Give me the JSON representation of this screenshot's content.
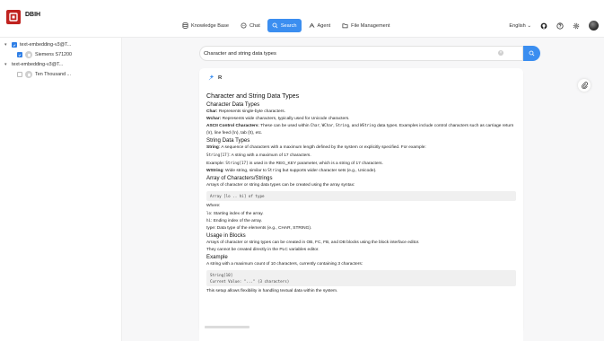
{
  "app": {
    "name": "DBIH"
  },
  "nav": [
    {
      "label": "Knowledge Base",
      "icon": "database-icon",
      "active": false
    },
    {
      "label": "Chat",
      "icon": "chat-icon",
      "active": false
    },
    {
      "label": "Search",
      "icon": "search-icon",
      "active": true
    },
    {
      "label": "Agent",
      "icon": "agent-icon",
      "active": false
    },
    {
      "label": "File Management",
      "icon": "folder-icon",
      "active": false
    }
  ],
  "topright": {
    "language": "English"
  },
  "sidebar": {
    "items": [
      {
        "label": "text-embedding-v3@T...",
        "checked": true,
        "expanded": true,
        "children": [
          {
            "label": "Siemens S71200",
            "checked": true
          }
        ]
      },
      {
        "label": "text-embedding-v3@T...",
        "checked": false,
        "expanded": true,
        "children": [
          {
            "label": "Ten Thousand ...",
            "checked": false
          }
        ]
      }
    ]
  },
  "search": {
    "value": "Character and string data types"
  },
  "result": {
    "label": "R",
    "title": "Character and String Data Types",
    "sec1": {
      "heading": "Character Data Types",
      "char_b": "Char:",
      "char_t": " Represents single-byte characters.",
      "wchar_b": "Wchar:",
      "wchar_t": " Represents wide characters, typically used for Unicode characters.",
      "ascii_b": "ASCII Control Characters",
      "ascii_t1": ": These can be used within ",
      "ascii_c1": "Char",
      "ascii_t2": ", ",
      "ascii_c2": "WChar",
      "ascii_t3": ", ",
      "ascii_c3": "String",
      "ascii_t4": ", and ",
      "ascii_c4": "WString",
      "ascii_t5": " data types. Examples include control characters such as carriage return (\\r), line feed (\\n), tab (\\t), etc."
    },
    "sec2": {
      "heading": "String Data Types",
      "string_b": "String",
      "string_t": ": A sequence of characters with a maximum length defined by the system or explicitly specified. For example:",
      "ex1_c": "String[17]",
      "ex1_t": ": A string with a maximum of 17 characters.",
      "ex2_t1": "Example: ",
      "ex2_c": "String[17]",
      "ex2_t2": " is used in the REG_KEY parameter, which is a string of 17 characters.",
      "wstring_b": "WString",
      "wstring_t1": ": Wide string, similar to ",
      "wstring_c": "String",
      "wstring_t2": " but supports wider character sets (e.g., Unicode)."
    },
    "sec3": {
      "heading": "Array of Characters/Strings",
      "line1": "Arrays of character or string data types can be created using the array syntax:",
      "code": "Array [lo .. hi] of type",
      "where": "Where:",
      "lo_c": "lo",
      "lo_t": ": Starting index of the array.",
      "hi_c": "hi",
      "hi_t": ": Ending index of the array.",
      "type_t": "type: Data type of the elements (e.g., CHAR, STRING)."
    },
    "sec4": {
      "heading": "Usage in Blocks",
      "line1": "Arrays of character or string types can be created in OB, FC, FB, and DB blocks using the block interface editor.",
      "line2": "They cannot be created directly in the PLC variables editor."
    },
    "sec5": {
      "heading": "Example",
      "line1": "A string with a maximum count of 10 characters, currently containing 3 characters:",
      "code1": "String[10]",
      "code2": "Current Value: \"...\" (3 characters)",
      "line2": "This setup allows flexibility in handling textual data within the system."
    }
  },
  "colors": {
    "brand": "#c0221f",
    "accent": "#3b8ef0",
    "background": "#f7f7f8"
  }
}
